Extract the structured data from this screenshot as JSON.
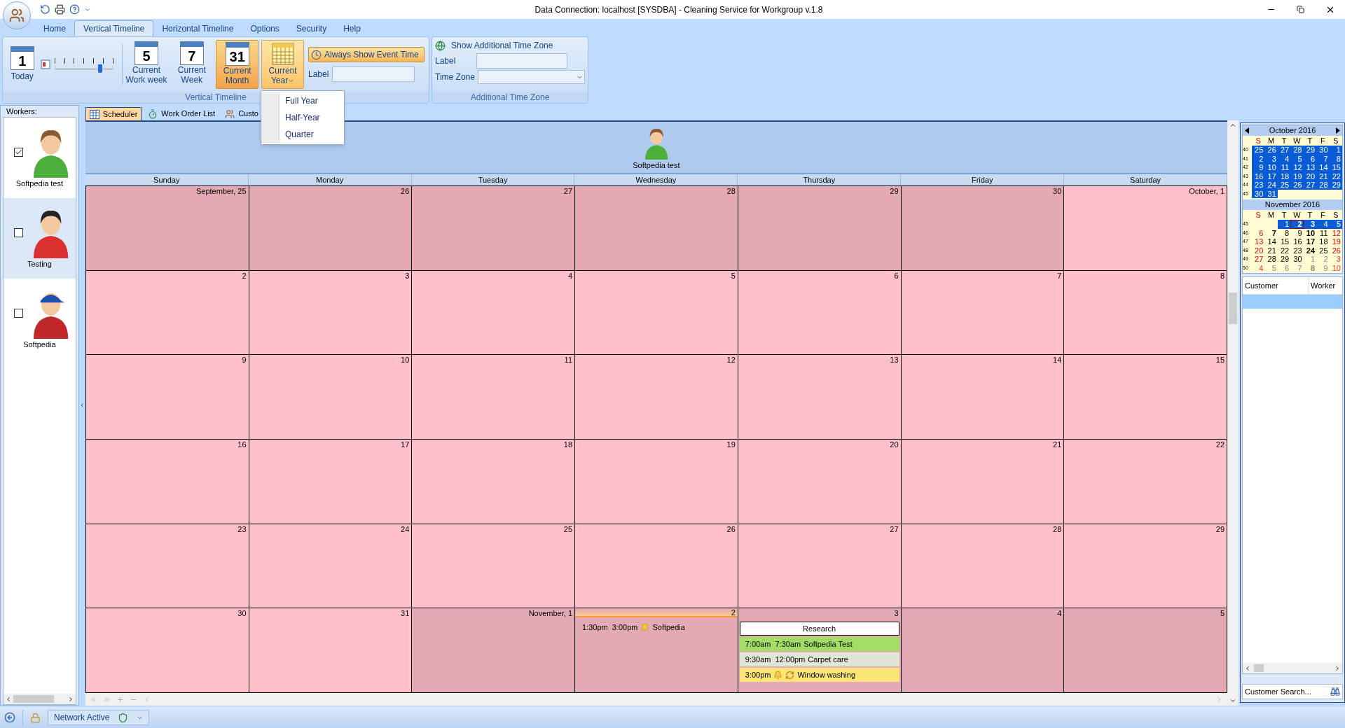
{
  "window": {
    "title": "Data Connection: localhost [SYSDBA] - Cleaning Service for Workgroup v.1.8"
  },
  "ribbon_tabs": [
    {
      "label": "Home",
      "selected": false
    },
    {
      "label": "Vertical Timeline",
      "selected": true
    },
    {
      "label": "Horizontal Timeline",
      "selected": false
    },
    {
      "label": "Options",
      "selected": false
    },
    {
      "label": "Security",
      "selected": false
    },
    {
      "label": "Help",
      "selected": false
    }
  ],
  "ribbon": {
    "today": {
      "icon_text": "1",
      "label": "Today"
    },
    "slider": {
      "level": 0.78
    },
    "view_buttons": [
      {
        "kind": "number",
        "icon_text": "5",
        "label": "Current Work week",
        "selected": false,
        "open": false
      },
      {
        "kind": "number",
        "icon_text": "7",
        "label": "Current Week",
        "selected": false,
        "open": false
      },
      {
        "kind": "number",
        "icon_text": "31",
        "label": "Current Month",
        "selected": true,
        "open": false
      },
      {
        "kind": "grid",
        "label": "Current Year",
        "selected": false,
        "open": true
      }
    ],
    "always_show": {
      "label": "Always Show Event Time",
      "on": true
    },
    "label_field": "Label",
    "group_label": "Vertical Timeline"
  },
  "time_zone": {
    "header": "Show Additional Time Zone",
    "label_field": "Label",
    "zone_field": "Time Zone",
    "group_label": "Additional Time Zone"
  },
  "menu": {
    "items": [
      "Full Year",
      "Half-Year",
      "Quarter"
    ]
  },
  "workers": {
    "title": "Workers:",
    "items": [
      {
        "name": "Softpedia test",
        "checked": true,
        "selected": false,
        "color": "#4caf3c",
        "kind": "plain"
      },
      {
        "name": "Testing",
        "checked": false,
        "selected": true,
        "color": "#d93030",
        "kind": "plain"
      },
      {
        "name": "Softpedia",
        "checked": false,
        "selected": false,
        "color": "#c0282a",
        "kind": "cap"
      }
    ]
  },
  "view_tabs": [
    {
      "label": "Scheduler",
      "selected": true
    },
    {
      "label": "Work Order List",
      "selected": false
    },
    {
      "label": "Custo",
      "selected": false
    }
  ],
  "scheduler": {
    "resource": "Softpedia test",
    "day_names": [
      "Sunday",
      "Monday",
      "Tuesday",
      "Wednesday",
      "Thursday",
      "Friday",
      "Saturday"
    ],
    "weeks": [
      [
        {
          "label": "September, 25",
          "other_month": true
        },
        {
          "label": "26",
          "other_month": true
        },
        {
          "label": "27",
          "other_month": true
        },
        {
          "label": "28",
          "other_month": true
        },
        {
          "label": "29",
          "other_month": true
        },
        {
          "label": "30",
          "other_month": true
        },
        {
          "label": "October, 1",
          "other_month": false
        }
      ],
      [
        {
          "label": "2",
          "other_month": false
        },
        {
          "label": "3",
          "other_month": false
        },
        {
          "label": "4",
          "other_month": false
        },
        {
          "label": "5",
          "other_month": false
        },
        {
          "label": "6",
          "other_month": false
        },
        {
          "label": "7",
          "other_month": false
        },
        {
          "label": "8",
          "other_month": false
        }
      ],
      [
        {
          "label": "9",
          "other_month": false
        },
        {
          "label": "10",
          "other_month": false
        },
        {
          "label": "11",
          "other_month": false
        },
        {
          "label": "12",
          "other_month": false
        },
        {
          "label": "13",
          "other_month": false
        },
        {
          "label": "14",
          "other_month": false
        },
        {
          "label": "15",
          "other_month": false
        }
      ],
      [
        {
          "label": "16",
          "other_month": false
        },
        {
          "label": "17",
          "other_month": false
        },
        {
          "label": "18",
          "other_month": false
        },
        {
          "label": "19",
          "other_month": false
        },
        {
          "label": "20",
          "other_month": false
        },
        {
          "label": "21",
          "other_month": false
        },
        {
          "label": "22",
          "other_month": false
        }
      ],
      [
        {
          "label": "23",
          "other_month": false
        },
        {
          "label": "24",
          "other_month": false
        },
        {
          "label": "25",
          "other_month": false
        },
        {
          "label": "26",
          "other_month": false
        },
        {
          "label": "27",
          "other_month": false
        },
        {
          "label": "28",
          "other_month": false
        },
        {
          "label": "29",
          "other_month": false
        }
      ],
      [
        {
          "label": "30",
          "other_month": false
        },
        {
          "label": "31",
          "other_month": false
        },
        {
          "label": "November, 1",
          "other_month": true
        },
        {
          "label": "2",
          "other_month": true,
          "today": true,
          "events": [
            {
              "kind": "timed",
              "start": "1:30pm",
              "end": "3:00pm",
              "alarm": true,
              "recurring": false,
              "title": "Softpedia"
            }
          ]
        },
        {
          "label": "3",
          "other_month": true,
          "events": [
            {
              "kind": "all-day",
              "title": "Research"
            },
            {
              "kind": "timed",
              "start": "7:00am",
              "end": "7:30am",
              "alarm": false,
              "recurring": false,
              "title": "Softpedia Test",
              "color": "#a2dd66"
            },
            {
              "kind": "timed",
              "start": "9:30am",
              "end": "12:00pm",
              "alarm": false,
              "recurring": false,
              "title": "Carpet care",
              "color": "#e1e5d5"
            },
            {
              "kind": "timed",
              "start": "3:00pm",
              "alarm": true,
              "recurring": true,
              "title": "Window washing",
              "color": "#fae576"
            }
          ]
        },
        {
          "label": "4",
          "other_month": true
        },
        {
          "label": "5",
          "other_month": true
        }
      ]
    ]
  },
  "mini_calendars": [
    {
      "title": "October 2016",
      "day_headers": [
        "S",
        "M",
        "T",
        "W",
        "T",
        "F",
        "S"
      ],
      "weeks": [
        {
          "number": "40",
          "days": [
            {
              "label": "25",
              "selected": true
            },
            {
              "label": "26",
              "selected": true
            },
            {
              "label": "27",
              "selected": true
            },
            {
              "label": "28",
              "selected": true
            },
            {
              "label": "29",
              "selected": true
            },
            {
              "label": "30",
              "selected": true
            },
            {
              "label": "1",
              "selected": true
            }
          ]
        },
        {
          "number": "41",
          "days": [
            {
              "label": "2",
              "selected": true
            },
            {
              "label": "3",
              "selected": true
            },
            {
              "label": "4",
              "selected": true
            },
            {
              "label": "5",
              "selected": true
            },
            {
              "label": "6",
              "selected": true
            },
            {
              "label": "7",
              "selected": true
            },
            {
              "label": "8",
              "selected": true
            }
          ]
        },
        {
          "number": "42",
          "days": [
            {
              "label": "9",
              "selected": true
            },
            {
              "label": "10",
              "selected": true
            },
            {
              "label": "11",
              "selected": true
            },
            {
              "label": "12",
              "selected": true
            },
            {
              "label": "13",
              "selected": true
            },
            {
              "label": "14",
              "selected": true
            },
            {
              "label": "15",
              "selected": true
            }
          ]
        },
        {
          "number": "43",
          "days": [
            {
              "label": "16",
              "selected": true
            },
            {
              "label": "17",
              "selected": true
            },
            {
              "label": "18",
              "selected": true
            },
            {
              "label": "19",
              "selected": true
            },
            {
              "label": "20",
              "selected": true
            },
            {
              "label": "21",
              "selected": true
            },
            {
              "label": "22",
              "selected": true
            }
          ]
        },
        {
          "number": "44",
          "days": [
            {
              "label": "23",
              "selected": true
            },
            {
              "label": "24",
              "selected": true
            },
            {
              "label": "25",
              "selected": true
            },
            {
              "label": "26",
              "selected": true
            },
            {
              "label": "27",
              "selected": true
            },
            {
              "label": "28",
              "selected": true
            },
            {
              "label": "29",
              "selected": true
            }
          ]
        },
        {
          "number": "45",
          "days": [
            {
              "label": "30",
              "selected": true
            },
            {
              "label": "31",
              "selected": true
            }
          ]
        }
      ]
    },
    {
      "title": "November 2016",
      "day_headers": [
        "S",
        "M",
        "T",
        "W",
        "T",
        "F",
        "S"
      ],
      "weeks": [
        {
          "number": "45",
          "days": [
            {
              "label": "1",
              "selected": true
            },
            {
              "label": "2",
              "selected": true,
              "bold": true,
              "today": true
            },
            {
              "label": "3",
              "selected": true,
              "bold": true
            },
            {
              "label": "4",
              "selected": true
            },
            {
              "label": "5",
              "selected": true
            }
          ]
        },
        {
          "number": "46",
          "days": [
            {
              "label": "6",
              "selected": false
            },
            {
              "label": "7",
              "selected": false,
              "bold": true
            },
            {
              "label": "8",
              "selected": false
            },
            {
              "label": "9",
              "selected": false
            },
            {
              "label": "10",
              "selected": false,
              "bold": true
            },
            {
              "label": "11",
              "selected": false
            },
            {
              "label": "12",
              "selected": false
            }
          ]
        },
        {
          "number": "47",
          "days": [
            {
              "label": "13",
              "selected": false
            },
            {
              "label": "14",
              "selected": false
            },
            {
              "label": "15",
              "selected": false
            },
            {
              "label": "16",
              "selected": false
            },
            {
              "label": "17",
              "selected": false,
              "bold": true
            },
            {
              "label": "18",
              "selected": false
            },
            {
              "label": "19",
              "selected": false
            }
          ]
        },
        {
          "number": "48",
          "days": [
            {
              "label": "20",
              "selected": false
            },
            {
              "label": "21",
              "selected": false
            },
            {
              "label": "22",
              "selected": false
            },
            {
              "label": "23",
              "selected": false
            },
            {
              "label": "24",
              "selected": false,
              "bold": true
            },
            {
              "label": "25",
              "selected": false
            },
            {
              "label": "26",
              "selected": false
            }
          ]
        },
        {
          "number": "49",
          "days": [
            {
              "label": "27",
              "selected": false
            },
            {
              "label": "28",
              "selected": false
            },
            {
              "label": "29",
              "selected": false
            },
            {
              "label": "30",
              "selected": false
            },
            {
              "label": "1",
              "selected": false,
              "muted": true
            },
            {
              "label": "2",
              "selected": false,
              "muted": true
            },
            {
              "label": "3",
              "selected": false,
              "muted": true
            }
          ]
        },
        {
          "number": "50",
          "days": [
            {
              "label": "4",
              "selected": false,
              "muted": true
            },
            {
              "label": "5",
              "selected": false,
              "muted": true
            },
            {
              "label": "6",
              "selected": false,
              "muted": true
            },
            {
              "label": "7",
              "selected": false,
              "muted": true
            },
            {
              "label": "8",
              "selected": false,
              "muted": true,
              "bold": true
            },
            {
              "label": "9",
              "selected": false,
              "muted": true
            },
            {
              "label": "10",
              "selected": false,
              "muted": true
            }
          ]
        }
      ]
    }
  ],
  "customer_grid": {
    "columns": [
      "Customer",
      "Worker"
    ]
  },
  "search_button": "Customer Search...",
  "status_bar": {
    "network": "Network Active"
  }
}
